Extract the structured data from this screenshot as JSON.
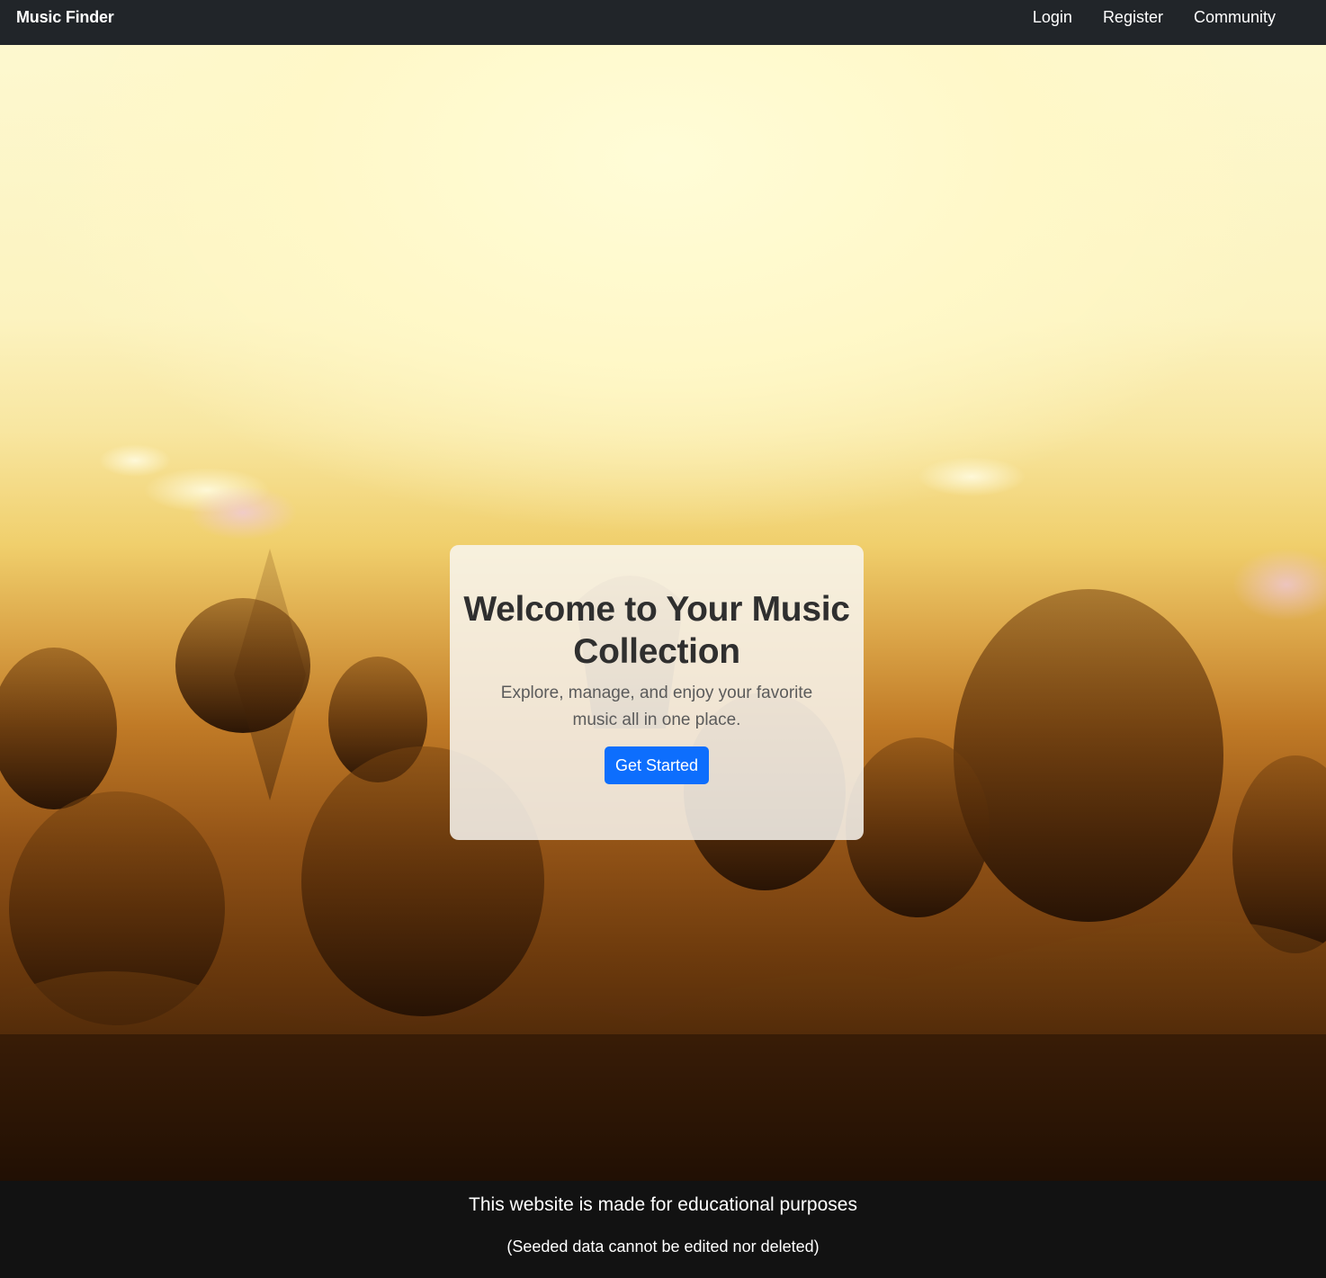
{
  "navbar": {
    "brand": "Music Finder",
    "links": [
      "Login",
      "Register",
      "Community"
    ]
  },
  "hero": {
    "background_image": "concert crowd silhouettes in warm golden stage light",
    "title": "Welcome to Your Music Collection",
    "subtitle": "Explore, manage, and enjoy your favorite music all in one place.",
    "cta_label": "Get Started"
  },
  "footer": {
    "main_text": "This website is made for educational purposes",
    "sub_text": "(Seeded data cannot be edited nor deleted)"
  },
  "colors": {
    "navbar_bg": "#212529",
    "accent": "#0d6efd",
    "footer_bg": "#000000"
  }
}
